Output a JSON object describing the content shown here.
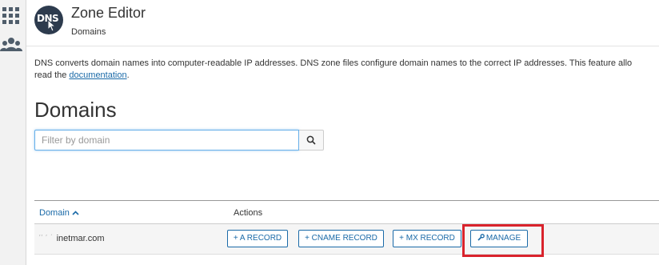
{
  "sidebar": {
    "icons": [
      "grid-icon",
      "users-icon"
    ]
  },
  "header": {
    "logo_text": "DNS",
    "title": "Zone Editor",
    "breadcrumb": "Domains"
  },
  "description": {
    "line1": "DNS converts domain names into computer-readable IP addresses. DNS zone files configure domain names to the correct IP addresses. This feature allo",
    "line2_prefix": "read the ",
    "link": "documentation",
    "line2_suffix": "."
  },
  "domains_heading": "Domains",
  "filter": {
    "placeholder": "Filter by domain",
    "value": "",
    "search_icon": "search-icon"
  },
  "table": {
    "columns": [
      "Domain",
      "Actions"
    ],
    "sort_indicator": "^",
    "rows": [
      {
        "domain_prefix": "′′ ′ ˊ",
        "domain": "inetmar.com",
        "actions": [
          "+ A RECORD",
          "+ CNAME RECORD",
          "+ MX RECORD",
          "MANAGE"
        ]
      }
    ]
  },
  "colors": {
    "accent": "#1a6aa8",
    "highlight": "#d9232c",
    "logo_bg": "#2d3b4e"
  }
}
